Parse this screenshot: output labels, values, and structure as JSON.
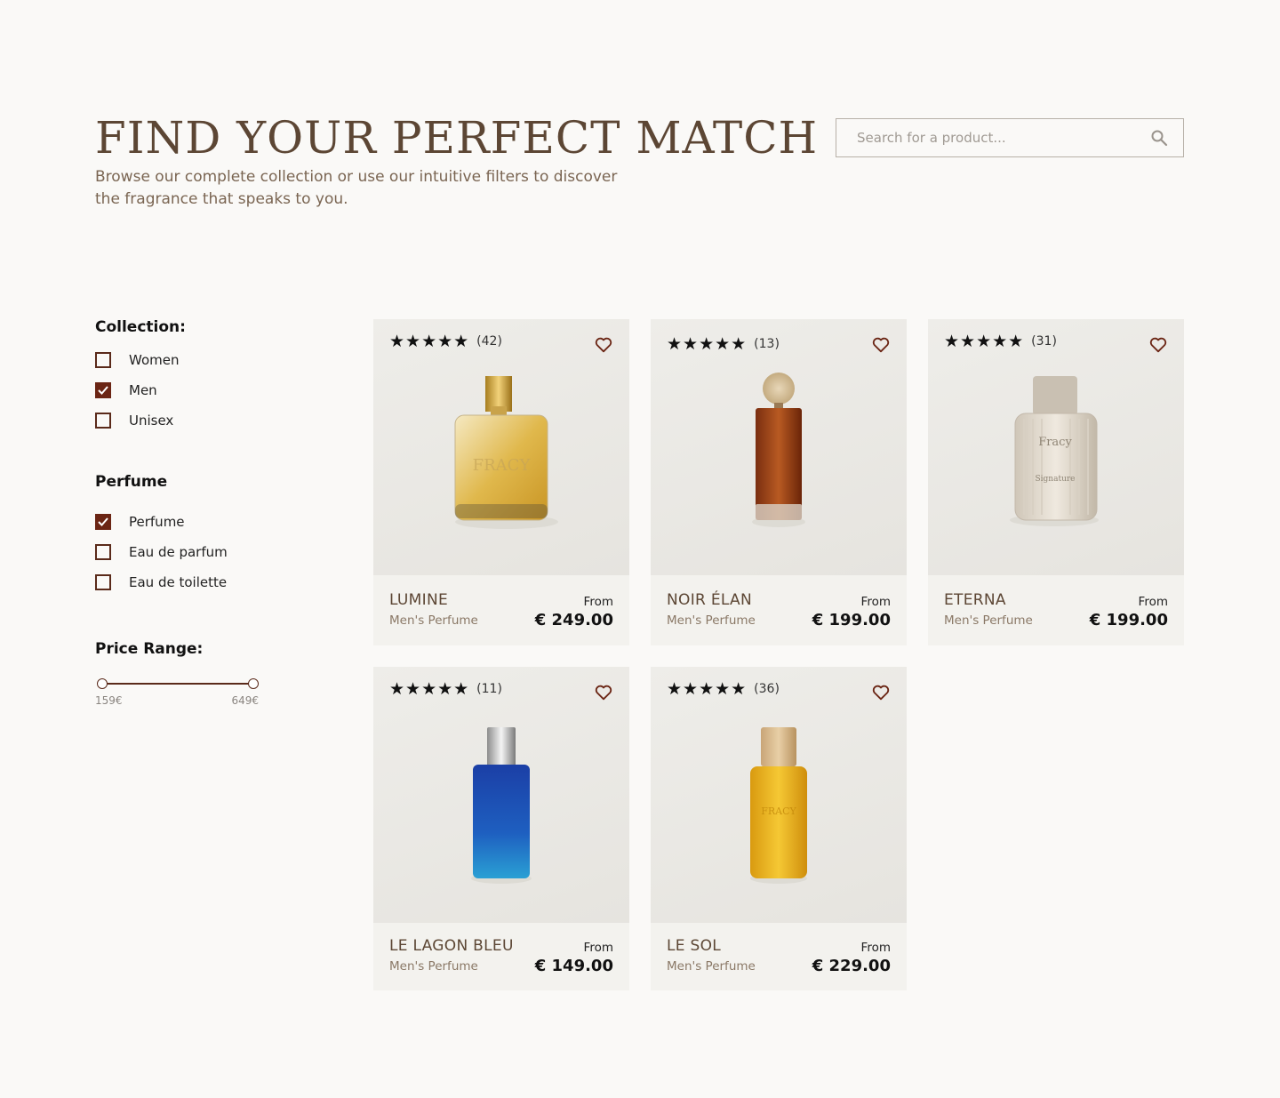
{
  "header": {
    "title": "FIND YOUR PERFECT MATCH",
    "subtitle": "Browse our complete collection or use our intuitive filters to discover the fragrance that speaks to you."
  },
  "search": {
    "placeholder": "Search for a product..."
  },
  "filters": {
    "collection": {
      "title": "Collection:",
      "options": [
        {
          "label": "Women",
          "checked": false
        },
        {
          "label": "Men",
          "checked": true
        },
        {
          "label": "Unisex",
          "checked": false
        }
      ]
    },
    "type": {
      "title": "Perfume",
      "options": [
        {
          "label": "Perfume",
          "checked": true
        },
        {
          "label": "Eau de parfum",
          "checked": false
        },
        {
          "label": "Eau de toilette",
          "checked": false
        }
      ]
    },
    "price": {
      "title": "Price Range:",
      "min_label": "159€",
      "max_label": "649€"
    }
  },
  "products": [
    {
      "name": "LUMINE",
      "category": "Men's Perfume",
      "from_label": "From",
      "price": "€ 249.00",
      "stars": "★★★★★",
      "reviews": "(42)",
      "bottle": "gold-round"
    },
    {
      "name": "NOIR ÉLAN",
      "category": "Men's Perfume",
      "from_label": "From",
      "price": "€ 199.00",
      "stars": "★★★★★",
      "reviews": "(13)",
      "bottle": "amber-tall"
    },
    {
      "name": "ETERNA",
      "category": "Men's Perfume",
      "from_label": "From",
      "price": "€ 199.00",
      "stars": "★★★★★",
      "reviews": "(31)",
      "bottle": "clear-ribbed"
    },
    {
      "name": "LE LAGON BLEU",
      "category": "Men's Perfume",
      "from_label": "From",
      "price": "€ 149.00",
      "stars": "★★★★★",
      "reviews": "(11)",
      "bottle": "blue-rect"
    },
    {
      "name": "LE SOL",
      "category": "Men's Perfume",
      "from_label": "From",
      "price": "€ 229.00",
      "stars": "★★★★★",
      "reviews": "(36)",
      "bottle": "yellow-rect"
    }
  ],
  "colors": {
    "accent": "#6b2514",
    "title": "#5c4634",
    "background": "#faf9f7"
  }
}
